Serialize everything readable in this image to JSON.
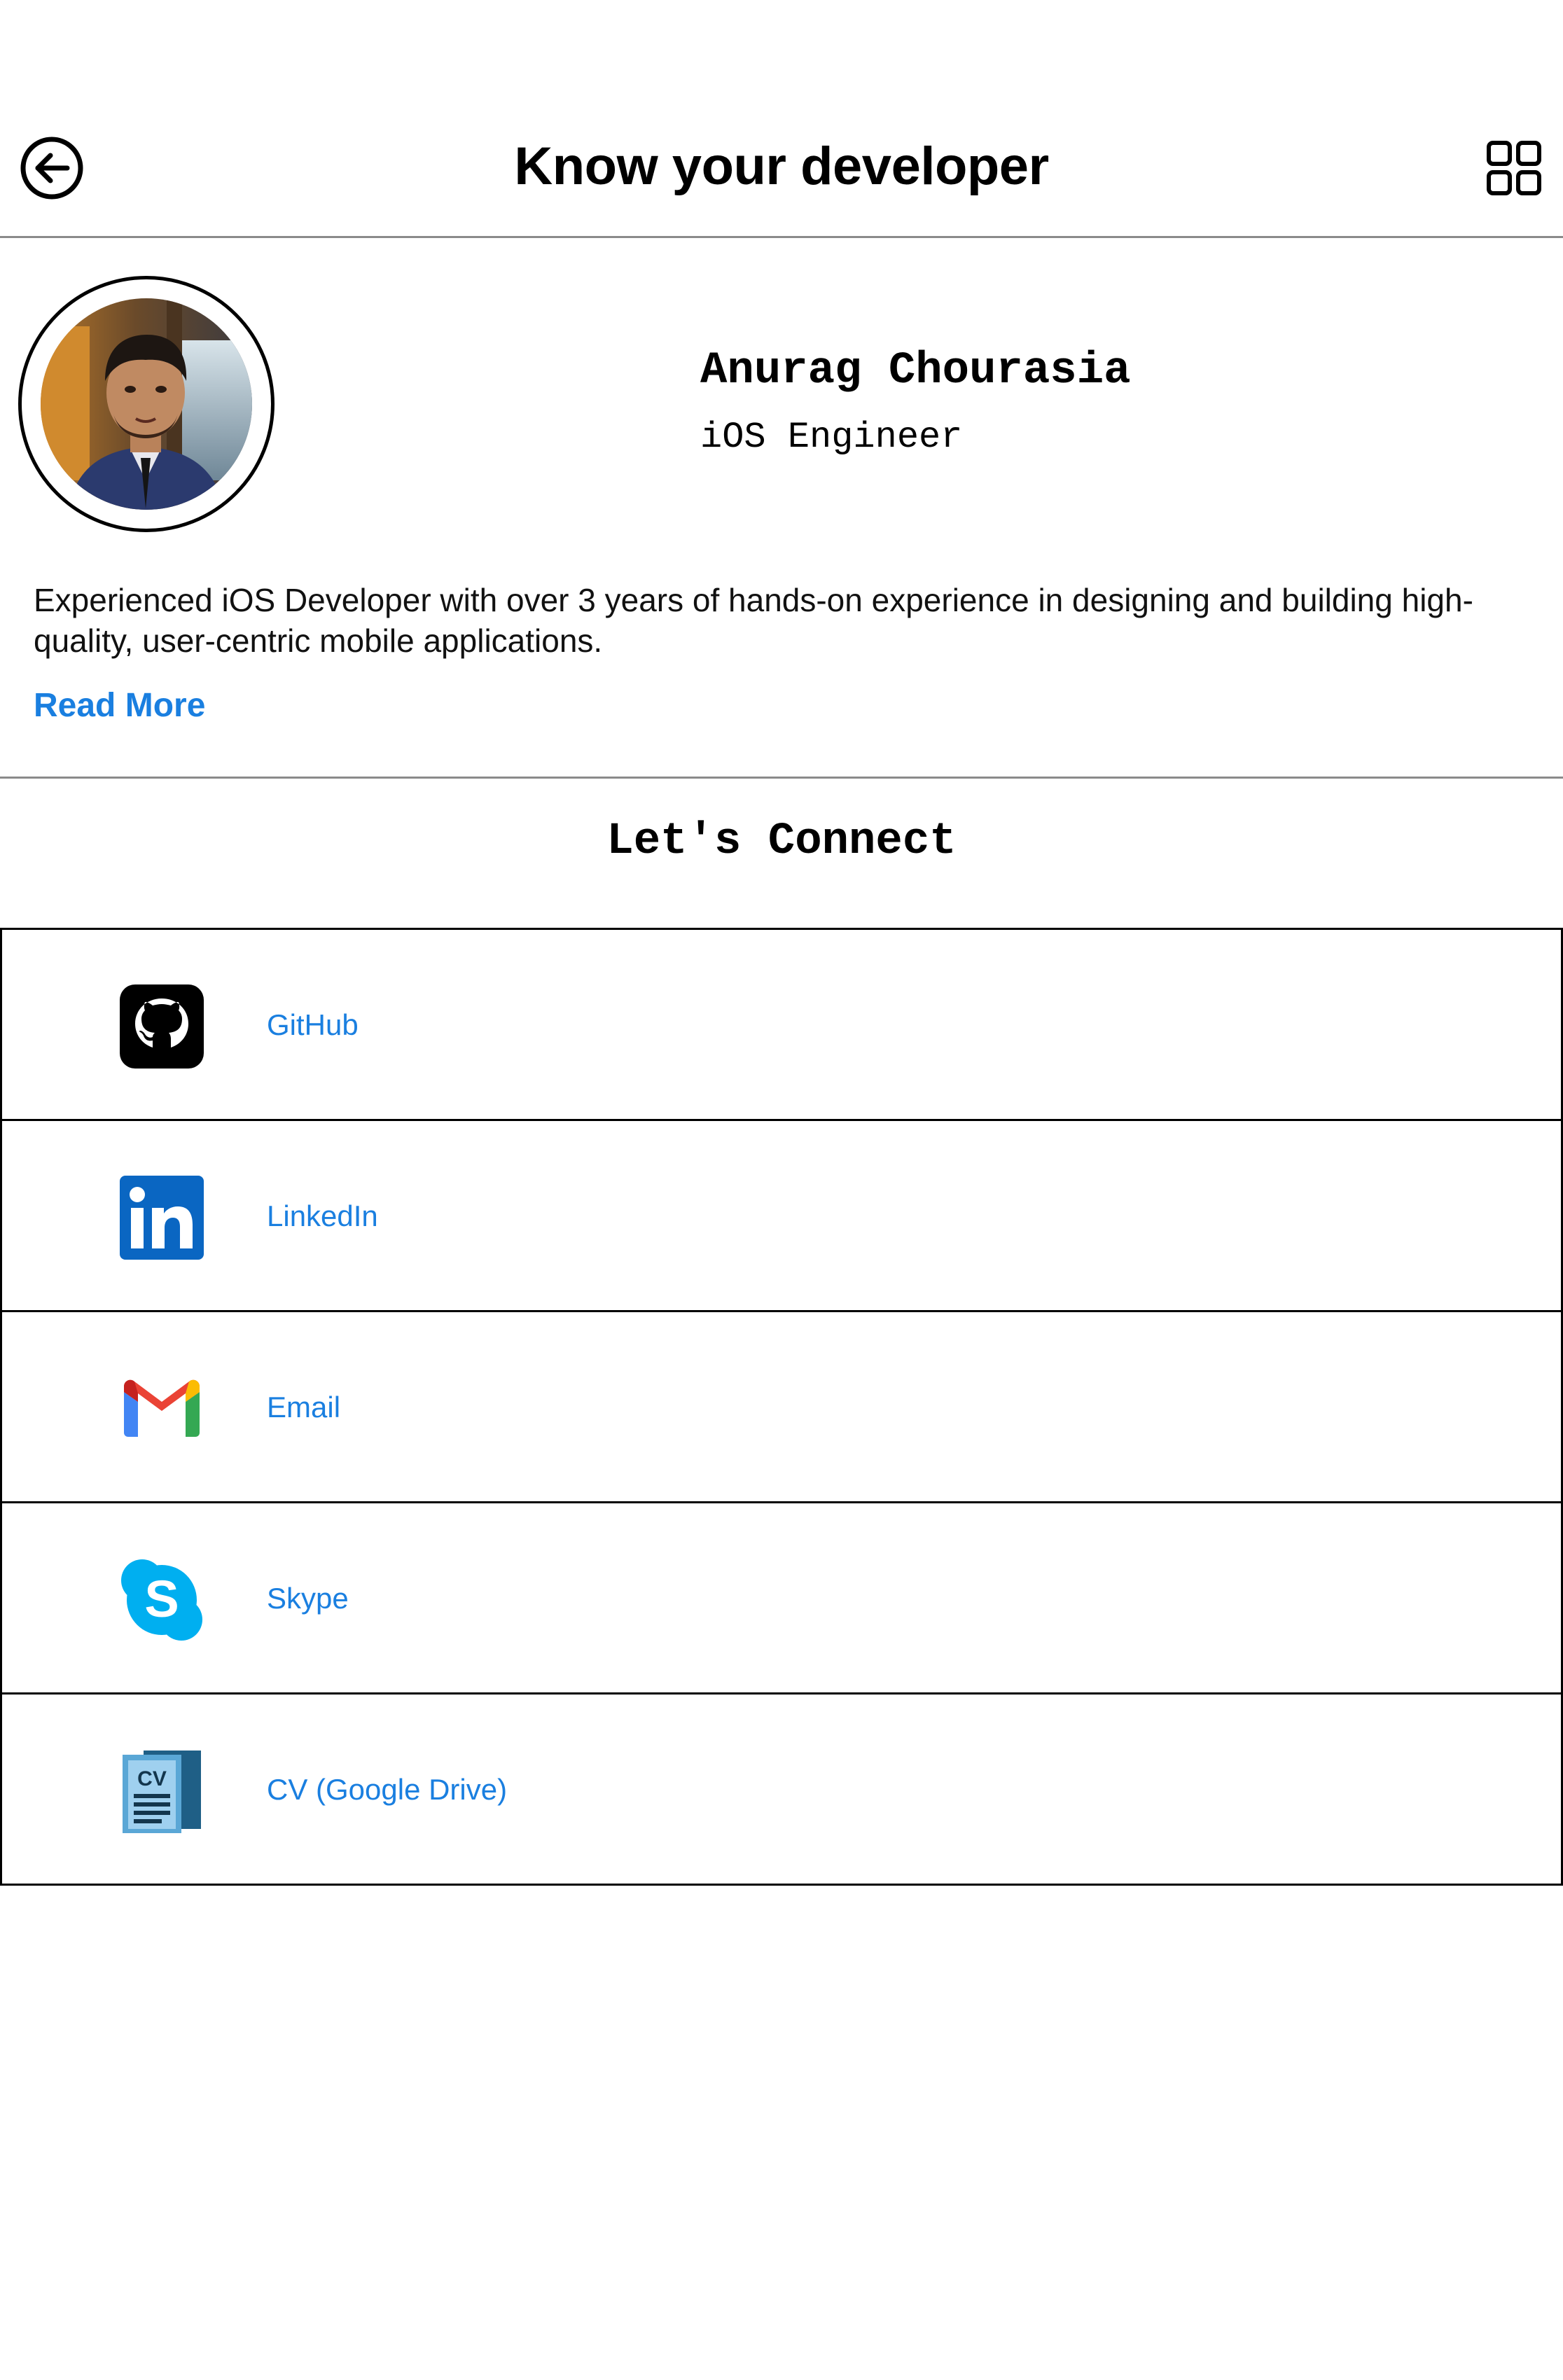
{
  "header": {
    "title": "Know your developer",
    "back_icon": "arrow-left-circle-icon",
    "menu_icon": "grid-icon"
  },
  "profile": {
    "name": "Anurag Chourasia",
    "role": "iOS Engineer",
    "bio": "Experienced iOS Developer with over 3 years of hands-on experience in designing and building high-quality, user-centric mobile applications.",
    "read_more": "Read More"
  },
  "connect": {
    "title": "Let's Connect",
    "items": [
      {
        "label": "GitHub",
        "icon": "github-icon"
      },
      {
        "label": "LinkedIn",
        "icon": "linkedin-icon"
      },
      {
        "label": "Email",
        "icon": "gmail-icon"
      },
      {
        "label": "Skype",
        "icon": "skype-icon"
      },
      {
        "label": "CV (Google Drive)",
        "icon": "cv-document-icon"
      }
    ]
  },
  "colors": {
    "link": "#1a7fe0",
    "divider": "#8a8a8a",
    "text": "#000000",
    "background": "#ffffff"
  }
}
